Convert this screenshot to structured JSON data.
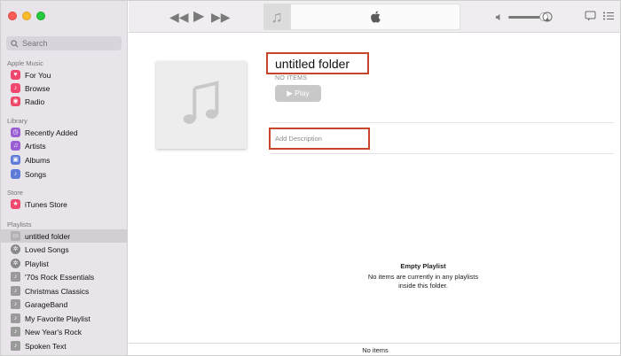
{
  "search": {
    "placeholder": "Search"
  },
  "sections": {
    "apple_music": "Apple Music",
    "library": "Library",
    "store": "Store",
    "playlists": "Playlists"
  },
  "apple_music_items": [
    {
      "label": "For You",
      "icon": "heart-icon"
    },
    {
      "label": "Browse",
      "icon": "music-note-icon"
    },
    {
      "label": "Radio",
      "icon": "radio-icon"
    }
  ],
  "library_items": [
    {
      "label": "Recently Added",
      "icon": "clock-icon"
    },
    {
      "label": "Artists",
      "icon": "microphone-icon"
    },
    {
      "label": "Albums",
      "icon": "album-icon"
    },
    {
      "label": "Songs",
      "icon": "music-note-icon"
    }
  ],
  "store_items": [
    {
      "label": "iTunes Store",
      "icon": "star-icon"
    }
  ],
  "playlist_items": [
    {
      "label": "untitled folder",
      "icon": "folder-icon",
      "selected": true
    },
    {
      "label": "Loved Songs",
      "icon": "gear-icon"
    },
    {
      "label": "Playlist",
      "icon": "gear-icon"
    },
    {
      "label": "'70s Rock Essentials",
      "icon": "playlist-icon"
    },
    {
      "label": "Christmas Classics",
      "icon": "playlist-icon"
    },
    {
      "label": "GarageBand",
      "icon": "playlist-icon"
    },
    {
      "label": "My Favorite Playlist",
      "icon": "playlist-icon"
    },
    {
      "label": "New Year's Rock",
      "icon": "playlist-icon"
    },
    {
      "label": "Spoken Text",
      "icon": "playlist-icon"
    }
  ],
  "main": {
    "title": "untitled folder",
    "items_count": "NO ITEMS",
    "play_label": "▶ Play",
    "description_placeholder": "Add Description",
    "empty_heading": "Empty Playlist",
    "empty_message": "No items are currently in any playlists inside this folder."
  },
  "status_bar": {
    "text": "No items"
  },
  "colors": {
    "highlight_border": "#c5452a",
    "sidebar_bg": "#e8e4ea",
    "selected_row": "#d2ced4"
  }
}
